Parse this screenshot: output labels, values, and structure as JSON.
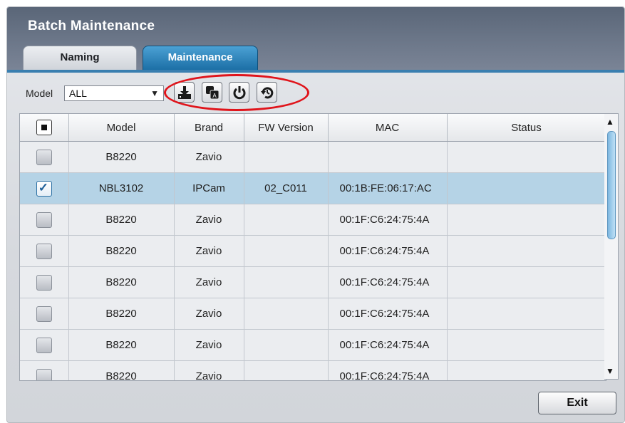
{
  "window": {
    "title": "Batch Maintenance"
  },
  "tabs": [
    {
      "label": "Naming",
      "active": false
    },
    {
      "label": "Maintenance",
      "active": true
    }
  ],
  "filter": {
    "label": "Model",
    "value": "ALL"
  },
  "toolbar": {
    "icons": [
      "firmware-upgrade-icon",
      "language-pack-icon",
      "reboot-icon",
      "factory-reset-icon"
    ],
    "highlight_color": "#e0141b"
  },
  "table": {
    "columns": [
      "",
      "Model",
      "Brand",
      "FW Version",
      "MAC",
      "Status"
    ],
    "rows": [
      {
        "checked": false,
        "model": "B8220",
        "brand": "Zavio",
        "fw": "",
        "mac": "",
        "status": ""
      },
      {
        "checked": true,
        "model": "NBL3102",
        "brand": "IPCam",
        "fw": "02_C011",
        "mac": "00:1B:FE:06:17:AC",
        "status": ""
      },
      {
        "checked": false,
        "model": "B8220",
        "brand": "Zavio",
        "fw": "",
        "mac": "00:1F:C6:24:75:4A",
        "status": ""
      },
      {
        "checked": false,
        "model": "B8220",
        "brand": "Zavio",
        "fw": "",
        "mac": "00:1F:C6:24:75:4A",
        "status": ""
      },
      {
        "checked": false,
        "model": "B8220",
        "brand": "Zavio",
        "fw": "",
        "mac": "00:1F:C6:24:75:4A",
        "status": ""
      },
      {
        "checked": false,
        "model": "B8220",
        "brand": "Zavio",
        "fw": "",
        "mac": "00:1F:C6:24:75:4A",
        "status": ""
      },
      {
        "checked": false,
        "model": "B8220",
        "brand": "Zavio",
        "fw": "",
        "mac": "00:1F:C6:24:75:4A",
        "status": ""
      },
      {
        "checked": false,
        "model": "B8220",
        "brand": "Zavio",
        "fw": "",
        "mac": "00:1F:C6:24:75:4A",
        "status": ""
      }
    ],
    "selected_color": "#b5d3e6"
  },
  "buttons": {
    "exit": "Exit"
  }
}
